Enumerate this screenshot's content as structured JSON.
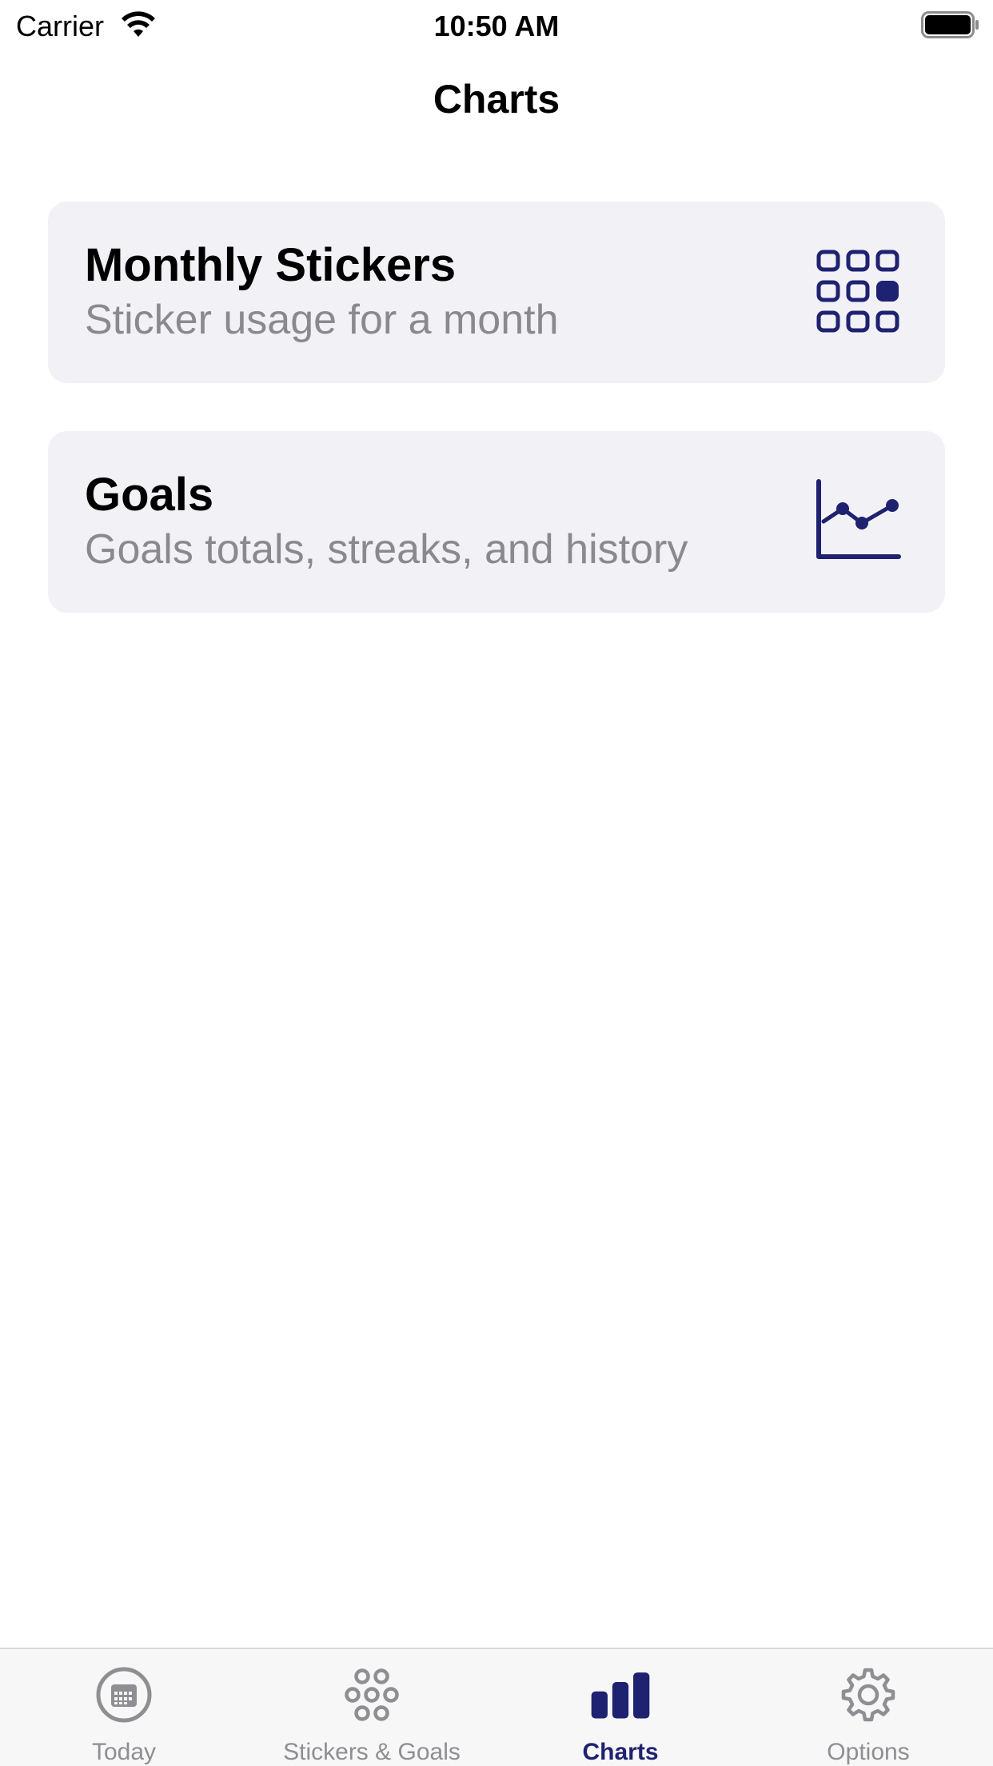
{
  "status_bar": {
    "carrier": "Carrier",
    "time": "10:50 AM"
  },
  "nav": {
    "title": "Charts"
  },
  "cards": [
    {
      "title": "Monthly Stickers",
      "subtitle": "Sticker usage for a month",
      "icon": "grid-icon"
    },
    {
      "title": "Goals",
      "subtitle": "Goals totals, streaks, and history",
      "icon": "line-chart-icon"
    }
  ],
  "tabs": [
    {
      "label": "Today",
      "icon": "calendar-icon",
      "active": false
    },
    {
      "label": "Stickers & Goals",
      "icon": "flower-icon",
      "active": false
    },
    {
      "label": "Charts",
      "icon": "bar-chart-icon",
      "active": true
    },
    {
      "label": "Options",
      "icon": "gear-icon",
      "active": false
    }
  ],
  "colors": {
    "accent": "#1f2270",
    "card_bg": "#f2f1f6",
    "secondary_text": "#8a8a8e",
    "tab_inactive": "#8e8e93"
  }
}
